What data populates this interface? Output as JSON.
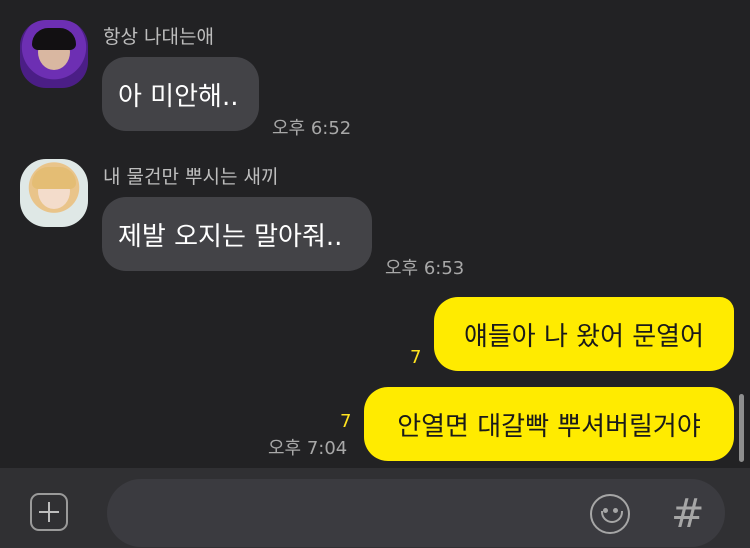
{
  "messages": [
    {
      "sender": "항상 나대는애",
      "text": "아 미안해..",
      "time": "오후 6:52",
      "avatar_icon": "profile-photo-1"
    },
    {
      "sender": "내 물건만 뿌시는 새끼",
      "text": "제발 오지는 말아줘..",
      "time": "오후 6:53",
      "avatar_icon": "profile-photo-2"
    },
    {
      "text": "얘들아 나 왔어 문열어",
      "unread": "7"
    },
    {
      "text": "안열면 대갈빡 뿌셔버릴거야",
      "unread": "7",
      "time": "오후 7:04"
    }
  ],
  "input_bar": {
    "placeholder": "",
    "plus_icon": "plus-square-icon",
    "emoji_icon": "emoji-icon",
    "hash_icon": "hash-icon"
  },
  "colors": {
    "background": "#222224",
    "incoming_bubble": "#434347",
    "outgoing_bubble": "#ffeb00",
    "unread_count": "#ffe31f",
    "input_bar": "#303033"
  }
}
